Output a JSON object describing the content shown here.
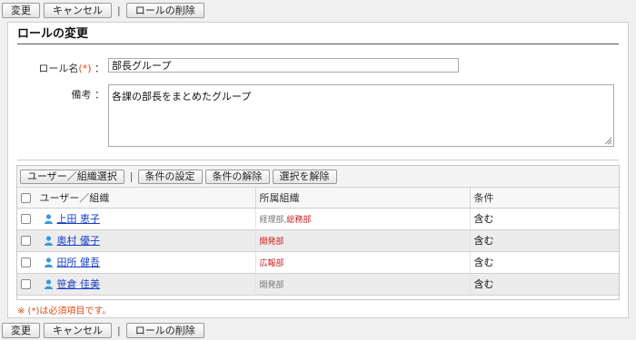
{
  "toolbar": {
    "change_label": "変更",
    "cancel_label": "キャンセル",
    "separator": "|",
    "delete_label": "ロールの削除"
  },
  "form": {
    "title": "ロールの変更",
    "name_label": "ロール名",
    "required_mark": "(*)",
    "colon": "：",
    "name_value": "部長グループ",
    "remarks_label": "備考",
    "remarks_value": "各課の部長をまとめたグループ"
  },
  "grid": {
    "buttons": {
      "select_user_org": "ユーザー／組織選択",
      "separator": "|",
      "set_condition": "条件の設定",
      "clear_condition": "条件の解除",
      "clear_selection": "選択を解除"
    },
    "columns": [
      "ユーザー／組織",
      "所属組織",
      "条件"
    ],
    "rows": [
      {
        "name": "上田 恵子",
        "org_gray": "経理部,",
        "org_red": "総務部",
        "condition": "含む"
      },
      {
        "name": "奥村 優子",
        "org_gray": "",
        "org_red": "開発部",
        "condition": "含む"
      },
      {
        "name": "田所 健吾",
        "org_gray": "",
        "org_red": "広報部",
        "condition": "含む"
      },
      {
        "name": "笹倉 佳美",
        "org_gray": "開発部",
        "org_red": "",
        "condition": "含む"
      }
    ]
  },
  "required_note": "※ (*)は必須項目です。",
  "colors": {
    "required": "#e04a1a",
    "link": "#1a3fc4",
    "org_highlight": "#c81e1e",
    "user_icon": "#3a9ad9"
  }
}
